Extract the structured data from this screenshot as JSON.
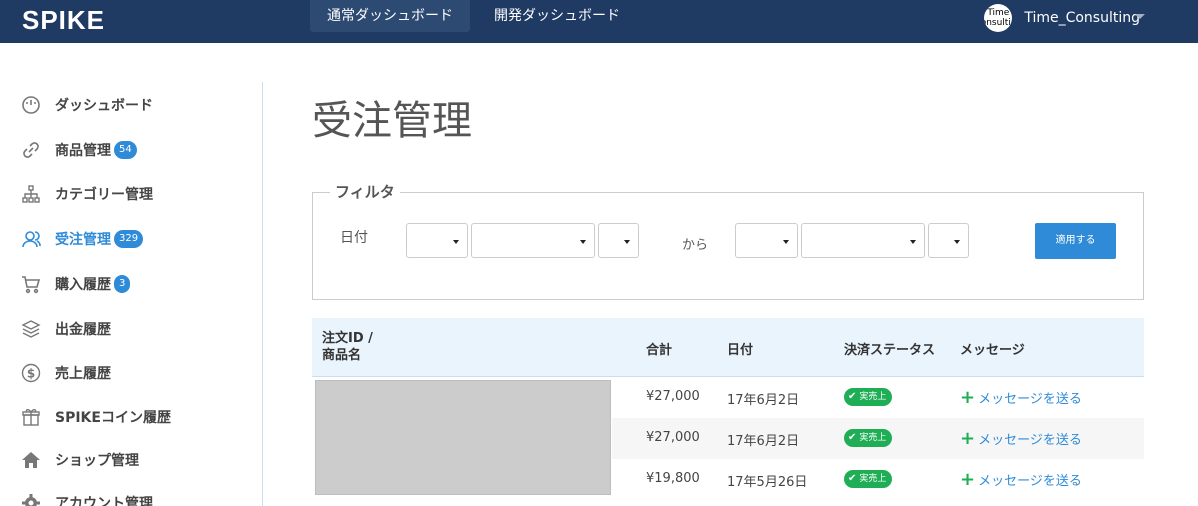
{
  "header": {
    "logo": "SPIKE",
    "tabs": [
      {
        "label": "通常ダッシュボード",
        "active": true
      },
      {
        "label": "開発ダッシュボード",
        "active": false
      }
    ],
    "avatar_text": "Time Consulting",
    "username": "Time_Consulting"
  },
  "sidebar": {
    "items": [
      {
        "label": "ダッシュボード",
        "icon": "speedometer-icon"
      },
      {
        "label": "商品管理",
        "icon": "link-icon",
        "badge": "54"
      },
      {
        "label": "カテゴリー管理",
        "icon": "hierarchy-icon"
      },
      {
        "label": "受注管理",
        "icon": "users-icon",
        "badge": "329",
        "active": true
      },
      {
        "label": "購入履歴",
        "icon": "cart-icon",
        "badge": "3"
      },
      {
        "label": "出金履歴",
        "icon": "layers-icon"
      },
      {
        "label": "売上履歴",
        "icon": "dollar-icon"
      },
      {
        "label": "SPIKEコイン履歴",
        "icon": "gift-icon"
      },
      {
        "label": "ショップ管理",
        "icon": "home-icon"
      },
      {
        "label": "アカウント管理",
        "icon": "gear-icon"
      }
    ]
  },
  "main": {
    "title": "受注管理",
    "filter": {
      "legend": "フィルタ",
      "date_label": "日付",
      "from_label": "から",
      "apply_label": "適用する"
    },
    "table": {
      "headers": [
        "注文ID /\n商品名",
        "合計",
        "日付",
        "決済ステータス",
        "メッセージ"
      ],
      "rows": [
        {
          "total": "¥27,000",
          "date": "17年6月2日",
          "status": "実売上",
          "message": "メッセージを送る"
        },
        {
          "total": "¥27,000",
          "date": "17年6月2日",
          "status": "実売上",
          "message": "メッセージを送る"
        },
        {
          "total": "¥19,800",
          "date": "17年5月26日",
          "status": "実売上",
          "message": "メッセージを送る"
        }
      ]
    }
  },
  "colors": {
    "header_bg": "#1f3a63",
    "accent": "#2f8bd8",
    "success": "#1fae55"
  }
}
